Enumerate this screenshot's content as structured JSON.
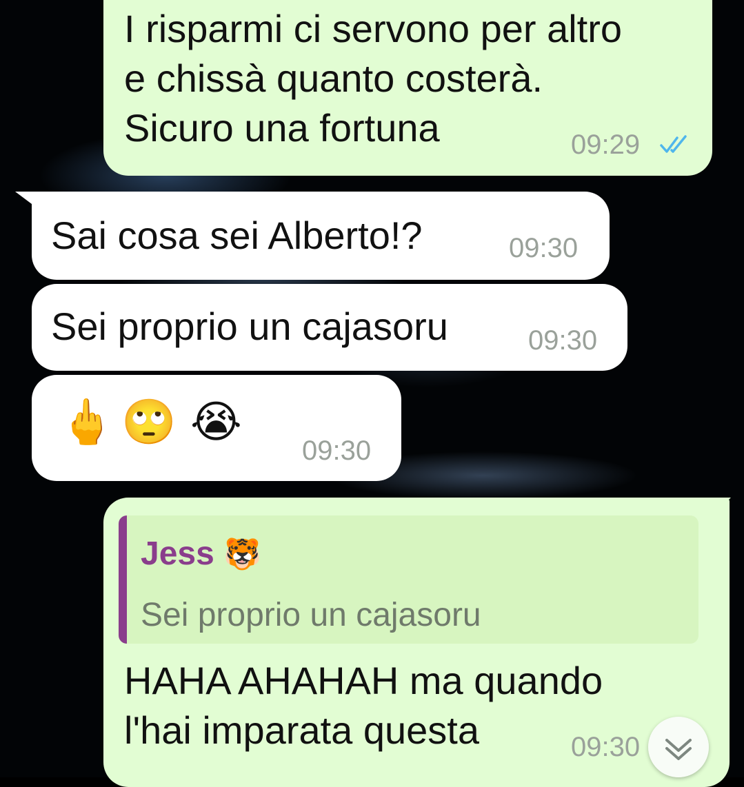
{
  "messages": [
    {
      "direction": "outgoing",
      "lines": [
        "I risparmi ci servono per altro",
        "e chissà quanto costerà.",
        "Sicuro una fortuna"
      ],
      "time": "09:29",
      "status": "read"
    },
    {
      "direction": "incoming",
      "text": "Sai cosa sei Alberto!?",
      "time": "09:30"
    },
    {
      "direction": "incoming",
      "text": "Sei proprio un cajasoru",
      "time": "09:30"
    },
    {
      "direction": "incoming",
      "emojis": [
        "🖕",
        "🙄",
        "😭"
      ],
      "time": "09:30"
    },
    {
      "direction": "outgoing",
      "reply": {
        "author": "Jess",
        "author_emoji": "🐯",
        "text": "Sei proprio un cajasoru"
      },
      "lines": [
        "HAHA AHAHAH ma quando",
        "l'hai imparata questa"
      ],
      "time": "09:30",
      "status": "delivered"
    }
  ],
  "colors": {
    "outgoing_bubble": "#e2fdd3",
    "incoming_bubble": "#ffffff",
    "reply_accent": "#8a3d8c",
    "read_ticks": "#4fb6ec",
    "timestamp": "#9aa19a"
  },
  "icons": {
    "read_status": "double-check-icon",
    "scroll_down": "chevron-double-down-icon"
  }
}
